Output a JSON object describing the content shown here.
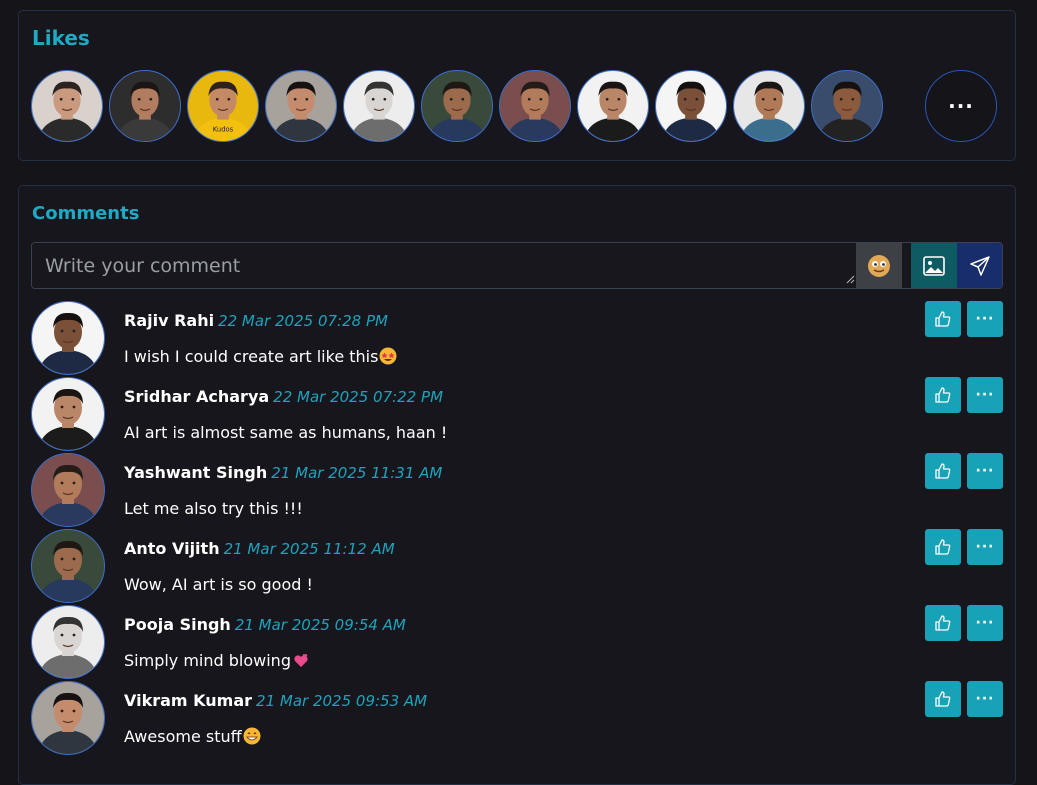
{
  "likes": {
    "title": "Likes",
    "avatars": [
      {
        "name": "liker-1",
        "skin": "#c99a7e",
        "hair": "#2b2320",
        "bg": "#d9d2cc",
        "shirt": "#2a2a2a"
      },
      {
        "name": "liker-2",
        "skin": "#b17c5f",
        "hair": "#1b1614",
        "bg": "#2d2d2d",
        "shirt": "#3a3a3a"
      },
      {
        "name": "liker-3",
        "skin": "#c48a65",
        "hair": "#2c211c",
        "bg": "#e9b80f",
        "shirt": "#f3c00f",
        "badge": "Kudos"
      },
      {
        "name": "liker-4",
        "skin": "#c48c6d",
        "hair": "#161212",
        "bg": "#a8a29c",
        "shirt": "#2f3640"
      },
      {
        "name": "liker-5",
        "skin": "#d8d5d2",
        "hair": "#333",
        "bg": "#ededed",
        "shirt": "#6d6d6d"
      },
      {
        "name": "liker-6",
        "skin": "#9c6a4c",
        "hair": "#1e1815",
        "bg": "#3a4a3a",
        "shirt": "#273a5e"
      },
      {
        "name": "liker-7",
        "skin": "#b27b5c",
        "hair": "#231c18",
        "bg": "#7a4e4e",
        "shirt": "#293a5e"
      },
      {
        "name": "liker-8",
        "skin": "#b98668",
        "hair": "#1a1412",
        "bg": "#f2f2f2",
        "shirt": "#1b1b1b"
      },
      {
        "name": "liker-9",
        "skin": "#7b5038",
        "hair": "#141010",
        "bg": "#f5f5f5",
        "shirt": "#1e2a44"
      },
      {
        "name": "liker-10",
        "skin": "#b07a58",
        "hair": "#1b1716",
        "bg": "#e7e7e7",
        "shirt": "#3b6e8d"
      },
      {
        "name": "liker-11",
        "skin": "#8c5b3e",
        "hair": "#16110f",
        "bg": "#3a4c6b",
        "shirt": "#222"
      }
    ],
    "more_label": "···"
  },
  "comments": {
    "title": "Comments",
    "input": {
      "placeholder": "Write your comment",
      "value": ""
    },
    "items": [
      {
        "author": "Rajiv Rahi",
        "time": "22 Mar 2025 07:28 PM",
        "text": "I wish I could create art like this",
        "emoji": "star-eyes",
        "avatar": {
          "skin": "#7b5038",
          "hair": "#141010",
          "bg": "#f5f5f5",
          "shirt": "#1e2a44"
        }
      },
      {
        "author": "Sridhar Acharya",
        "time": "22 Mar 2025 07:22 PM",
        "text": "AI art is almost same as humans, haan !",
        "emoji": "",
        "avatar": {
          "skin": "#b98668",
          "hair": "#1a1412",
          "bg": "#f2f2f2",
          "shirt": "#1b1b1b"
        }
      },
      {
        "author": "Yashwant Singh",
        "time": "21 Mar 2025 11:31 AM",
        "text": "Let me also try this !!!",
        "emoji": "",
        "avatar": {
          "skin": "#b27b5c",
          "hair": "#231c18",
          "bg": "#7a4e4e",
          "shirt": "#293a5e"
        }
      },
      {
        "author": "Anto Vijith",
        "time": "21 Mar 2025 11:12 AM",
        "text": "Wow, AI art is so good !",
        "emoji": "",
        "avatar": {
          "skin": "#9c6a4c",
          "hair": "#1e1815",
          "bg": "#3a4a3a",
          "shirt": "#273a5e"
        }
      },
      {
        "author": "Pooja Singh",
        "time": "21 Mar 2025 09:54 AM",
        "text": "Simply mind blowing",
        "emoji": "hearts",
        "avatar": {
          "skin": "#d8d5d2",
          "hair": "#333",
          "bg": "#ededed",
          "shirt": "#6d6d6d"
        }
      },
      {
        "author": "Vikram Kumar",
        "time": "21 Mar 2025 09:53 AM",
        "text": "Awesome stuff",
        "emoji": "grin",
        "avatar": {
          "skin": "#c48c6d",
          "hair": "#161212",
          "bg": "#a8a29c",
          "shirt": "#2f3640"
        }
      }
    ],
    "more_label": "···"
  },
  "colors": {
    "accent": "#1eaac4",
    "button": "#17a2b8",
    "timestamp": "#1ea3bd",
    "background": "#141419",
    "border": "#243044",
    "image_button": "#0e5b63",
    "send_button": "#182d6b"
  },
  "icons": {
    "emoji_button": "smiley-icon",
    "image_button": "image-icon",
    "send_button": "send-icon",
    "like_button": "thumbs-up-icon",
    "more_button": "ellipsis-icon"
  }
}
